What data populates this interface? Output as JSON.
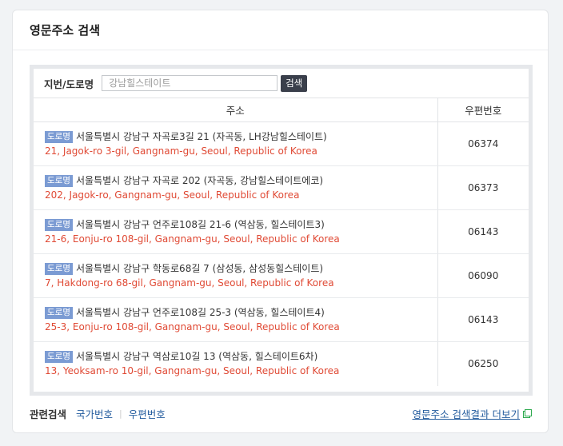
{
  "title": "영문주소 검색",
  "search": {
    "label": "지번/도로명",
    "placeholder": "강남힐스테이트",
    "button": "검색"
  },
  "table": {
    "headers": [
      "주소",
      "우편번호"
    ],
    "rows": [
      {
        "badge": "도로명",
        "korean": "서울특별시 강남구 자곡로3길 21 (자곡동, LH강남힐스테이트)",
        "english": "21, Jagok-ro 3-gil, Gangnam-gu, Seoul, Republic of Korea",
        "zip": "06374"
      },
      {
        "badge": "도로명",
        "korean": "서울특별시 강남구 자곡로 202 (자곡동, 강남힐스테이트에코)",
        "english": "202, Jagok-ro, Gangnam-gu, Seoul, Republic of Korea",
        "zip": "06373"
      },
      {
        "badge": "도로명",
        "korean": "서울특별시 강남구 언주로108길 21-6 (역삼동, 힐스테이트3)",
        "english": "21-6, Eonju-ro 108-gil, Gangnam-gu, Seoul, Republic of Korea",
        "zip": "06143"
      },
      {
        "badge": "도로명",
        "korean": "서울특별시 강남구 학동로68길 7 (삼성동, 삼성동힐스테이트)",
        "english": "7, Hakdong-ro 68-gil, Gangnam-gu, Seoul, Republic of Korea",
        "zip": "06090"
      },
      {
        "badge": "도로명",
        "korean": "서울특별시 강남구 언주로108길 25-3 (역삼동, 힐스테이트4)",
        "english": "25-3, Eonju-ro 108-gil, Gangnam-gu, Seoul, Republic of Korea",
        "zip": "06143"
      },
      {
        "badge": "도로명",
        "korean": "서울특별시 강남구 역삼로10길 13 (역삼동, 힐스테이트6차)",
        "english": "13, Yeoksam-ro 10-gil, Gangnam-gu, Seoul, Republic of Korea",
        "zip": "06250"
      }
    ]
  },
  "footer": {
    "label": "관련검색",
    "links": [
      "국가번호",
      "우편번호"
    ],
    "more": "영문주소 검색결과 더보기",
    "more_icon": "external-link-icon"
  },
  "colors": {
    "badge": "#7b9bd3",
    "english_text": "#e04a35",
    "link": "#245c9e",
    "button": "#3a3f4b",
    "external_icon": "#2eaa4f"
  }
}
